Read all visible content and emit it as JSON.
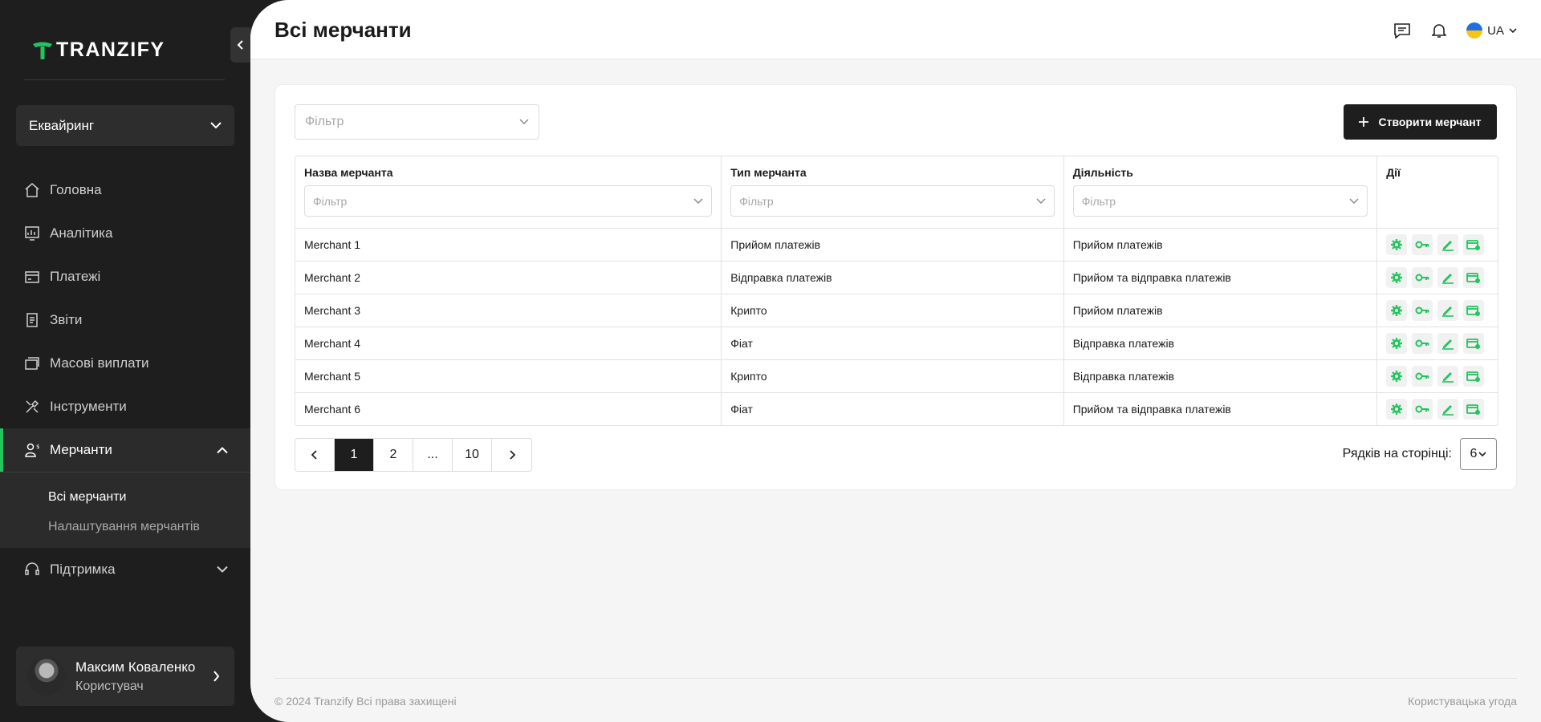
{
  "brand": {
    "name": "TRANZIFY",
    "accent": "#22c55e"
  },
  "sidebar": {
    "module": "Еквайринг",
    "items": [
      {
        "label": "Головна",
        "icon": "home-icon"
      },
      {
        "label": "Аналітика",
        "icon": "analytics-icon"
      },
      {
        "label": "Платежі",
        "icon": "payments-icon"
      },
      {
        "label": "Звіти",
        "icon": "reports-icon"
      },
      {
        "label": "Масові виплати",
        "icon": "mass-payouts-icon"
      },
      {
        "label": "Інструменти",
        "icon": "tools-icon"
      },
      {
        "label": "Мерчанти",
        "icon": "merchants-icon",
        "active": true
      },
      {
        "label": "Підтримка",
        "icon": "support-icon"
      }
    ],
    "subitems": [
      {
        "label": "Всі мерчанти",
        "active": true
      },
      {
        "label": "Налаштування мерчантів"
      }
    ],
    "user": {
      "name": "Максим Коваленко",
      "role": "Користувач"
    }
  },
  "header": {
    "title": "Всі мерчанти",
    "lang": "UA"
  },
  "toolbar": {
    "filter_placeholder": "Фільтр",
    "create_label": "Створити мерчант"
  },
  "table": {
    "columns": [
      "Назва мерчанта",
      "Тип мерчанта",
      "Діяльність",
      "Дії"
    ],
    "filter_placeholder": "Фільтр",
    "rows": [
      {
        "name": "Merchant 1",
        "type": "Прийом платежів",
        "activity": "Прийом платежів"
      },
      {
        "name": "Merchant 2",
        "type": "Відправка платежів",
        "activity": "Прийом та відправка платежів"
      },
      {
        "name": "Merchant 3",
        "type": "Крипто",
        "activity": "Прийом платежів"
      },
      {
        "name": "Merchant 4",
        "type": "Фіат",
        "activity": "Відправка платежів"
      },
      {
        "name": "Merchant 5",
        "type": "Крипто",
        "activity": "Відправка платежів"
      },
      {
        "name": "Merchant 6",
        "type": "Фіат",
        "activity": "Прийом та відправка платежів"
      }
    ]
  },
  "pagination": {
    "pages": [
      "1",
      "2",
      "...",
      "10"
    ],
    "current": "1"
  },
  "rows_per_page": {
    "label": "Рядків на сторінці:",
    "value": "6"
  },
  "footer": {
    "copyright": "© 2024 Tranzify Всі права захищені",
    "terms": "Користувацька угода"
  }
}
